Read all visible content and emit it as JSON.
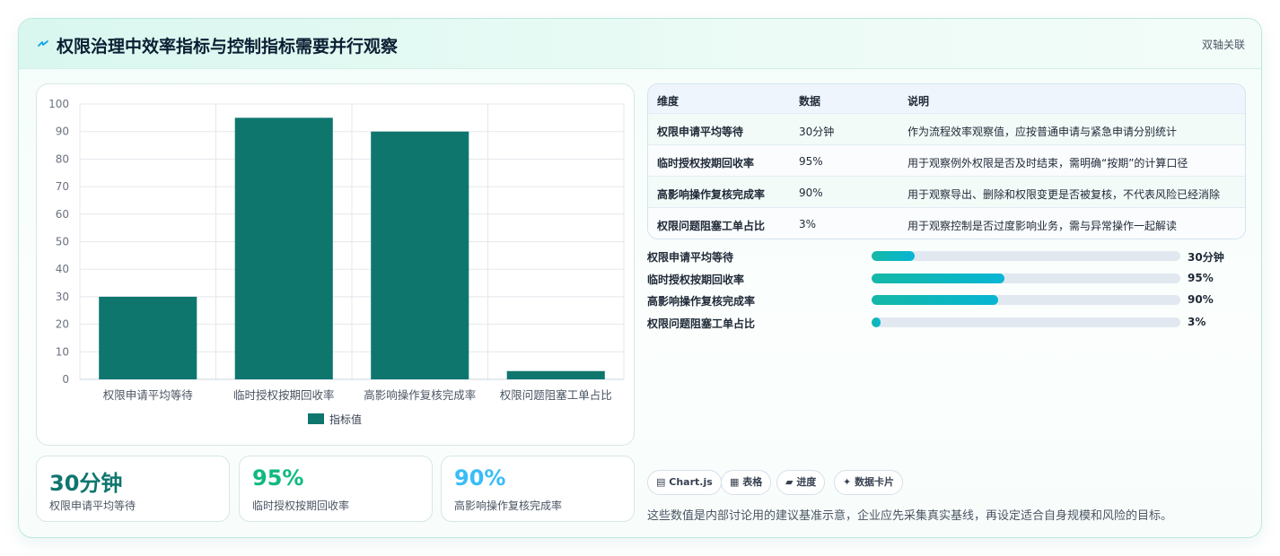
{
  "header": {
    "title": "权限治理中效率指标与控制指标需要并行观察",
    "badge": "双轴关联",
    "icon": "lightning-icon"
  },
  "chart_data": {
    "type": "bar",
    "categories": [
      "权限申请平均等待",
      "临时授权按期回收率",
      "高影响操作复核完成率",
      "权限问题阻塞工单占比"
    ],
    "series": [
      {
        "name": "指标值",
        "values": [
          30,
          95,
          90,
          3
        ]
      }
    ],
    "ylim": [
      0,
      100
    ],
    "yticks": [
      0,
      10,
      20,
      30,
      40,
      50,
      60,
      70,
      80,
      90,
      100
    ],
    "legend": "bottom",
    "grid": true,
    "colors": {
      "bar": "#0f766e"
    }
  },
  "stats": [
    {
      "value": "30分钟",
      "label": "权限申请平均等待",
      "color": "#0f766e"
    },
    {
      "value": "95%",
      "label": "临时授权按期回收率",
      "color": "#10b981"
    },
    {
      "value": "90%",
      "label": "高影响操作复核完成率",
      "color": "#38bdf8"
    }
  ],
  "table": {
    "headers": [
      "维度",
      "数据",
      "说明"
    ],
    "rows": [
      [
        "权限申请平均等待",
        "30分钟",
        "作为流程效率观察值，应按普通申请与紧急申请分别统计"
      ],
      [
        "临时授权按期回收率",
        "95%",
        "用于观察例外权限是否及时结束，需明确“按期”的计算口径"
      ],
      [
        "高影响操作复核完成率",
        "90%",
        "用于观察导出、删除和权限变更是否被复核，不代表风险已经消除"
      ],
      [
        "权限问题阻塞工单占比",
        "3%",
        "用于观察控制是否过度影响业务，需与异常操作一起解读"
      ]
    ]
  },
  "progress": [
    {
      "label": "权限申请平均等待",
      "value": "30分钟",
      "fraction": 0.14
    },
    {
      "label": "临时授权按期回收率",
      "value": "95%",
      "fraction": 0.43
    },
    {
      "label": "高影响操作复核完成率",
      "value": "90%",
      "fraction": 0.41
    },
    {
      "label": "权限问题阻塞工单占比",
      "value": "3%",
      "fraction": 0.03
    }
  ],
  "chips": [
    {
      "icon": "chart-icon",
      "glyph": "▤",
      "label": "Chart.js"
    },
    {
      "icon": "table-icon",
      "glyph": "▦",
      "label": "表格"
    },
    {
      "icon": "progress-icon",
      "glyph": "▰",
      "label": "进度"
    },
    {
      "icon": "sparkle-icon",
      "glyph": "✦",
      "label": "数据卡片"
    }
  ],
  "note": "这些数值是内部讨论用的建议基准示意，企业应先采集真实基线，再设定适合自身规模和风险的目标。"
}
